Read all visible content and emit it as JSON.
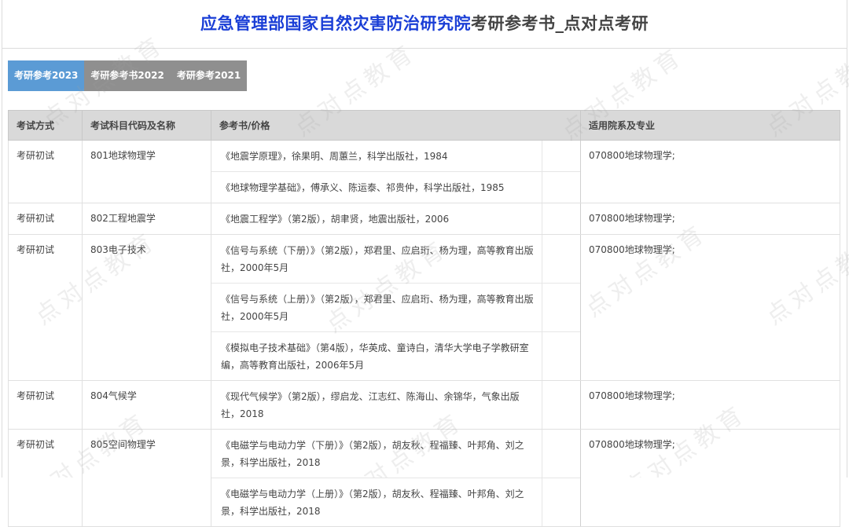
{
  "header": {
    "title_highlight": "应急管理部国家自然灾害防治研究院",
    "title_rest": "考研参考书_点对点考研"
  },
  "tabs": [
    {
      "label": "考研参考2023",
      "active": true
    },
    {
      "label": "考研参考书2022",
      "active": false
    },
    {
      "label": "考研参考2021",
      "active": false
    }
  ],
  "table": {
    "headers": [
      "考试方式",
      "考试科目代码及名称",
      "参考书/价格",
      "适用院系及专业"
    ],
    "rows": [
      {
        "mode": "考研初试",
        "subject": "801地球物理学",
        "books": [
          "《地震学原理》，徐果明、周蕙兰，科学出版社，1984",
          "《地球物理学基础》，傅承义、陈运泰、祁贵仲，科学出版社，1985"
        ],
        "major": "070800地球物理学;"
      },
      {
        "mode": "考研初试",
        "subject": "802工程地震学",
        "books": [
          "《地震工程学》（第2版），胡聿贤，地震出版社，2006"
        ],
        "major": "070800地球物理学;"
      },
      {
        "mode": "考研初试",
        "subject": "803电子技术",
        "books": [
          "《信号与系统（下册）》（第2版），郑君里、应启珩、杨为理，高等教育出版社，2000年5月",
          "《信号与系统（上册）》（第2版），郑君里、应启珩、杨为理，高等教育出版社，2000年5月",
          "《模拟电子技术基础》（第4版），华英成、童诗白，清华大学电子学教研室编，高等教育出版社，2006年5月"
        ],
        "major": "070800地球物理学;"
      },
      {
        "mode": "考研初试",
        "subject": "804气候学",
        "books": [
          "《现代气候学》（第2版），缪启龙、江志红、陈海山、余锦华，气象出版社，2018"
        ],
        "major": "070800地球物理学;"
      },
      {
        "mode": "考研初试",
        "subject": "805空间物理学",
        "books": [
          "《电磁学与电动力学（下册）》（第2版），胡友秋、程福臻、叶邦角、刘之景，科学出版社，2018",
          "《电磁学与电动力学（上册）》（第2版），胡友秋、程福臻、叶邦角、刘之景，科学出版社，2018"
        ],
        "major": "070800地球物理学;"
      }
    ]
  },
  "watermark": "点对点教育"
}
